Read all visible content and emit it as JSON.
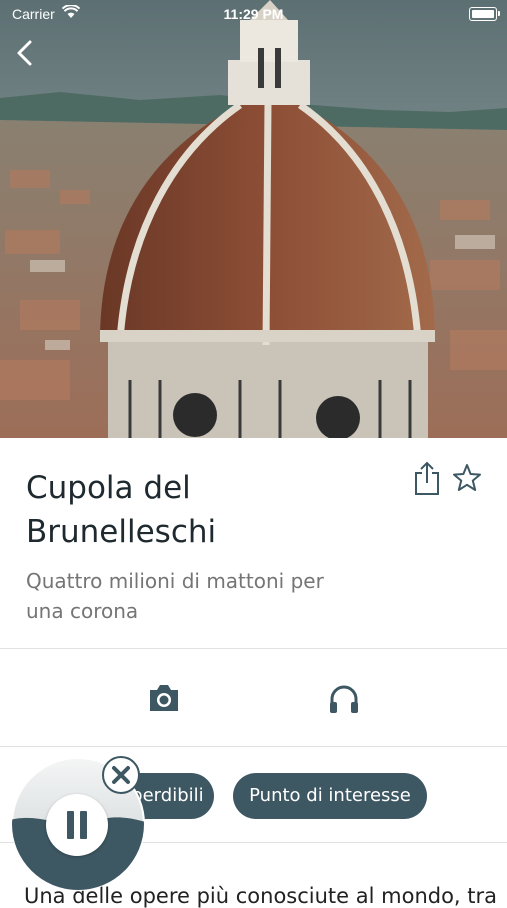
{
  "status_bar": {
    "carrier": "Carrier",
    "time": "11:29 PM"
  },
  "hero": {
    "image_subject": "Dome of Florence Cathedral over the city"
  },
  "place": {
    "title_line1": "Cupola del",
    "title_line2": "Brunelleschi",
    "subtitle_line1": "Quattro milioni di mattoni per",
    "subtitle_line2": "una corona"
  },
  "actions": {
    "share_icon": "share-icon",
    "favorite_icon": "star-icon"
  },
  "media": {
    "photo_icon": "camera-icon",
    "audio_icon": "headphones-icon"
  },
  "tags": [
    {
      "label": "Imperdibili"
    },
    {
      "label": "Punto di interesse"
    }
  ],
  "description_preview": "Una delle opere più conosciute al mondo, tra",
  "player": {
    "state": "playing",
    "close_icon": "close-icon",
    "pause_icon": "pause-icon"
  },
  "colors": {
    "accent": "#3e5863",
    "text_primary": "#1f2a30",
    "text_secondary": "#757575"
  }
}
